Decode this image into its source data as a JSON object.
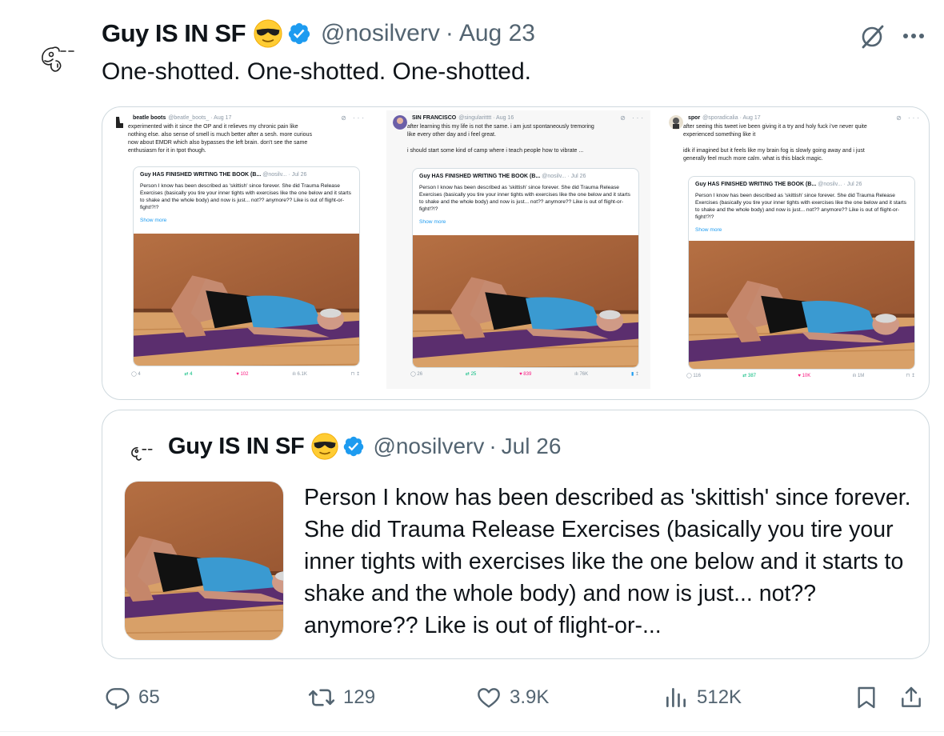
{
  "tweet": {
    "author_name": "Guy IS IN SF",
    "author_emoji": "sunglasses-face-emoji",
    "verified_badge": "verified-badge-icon",
    "handle": "@nosilverv",
    "separator": "·",
    "date": "Aug 23",
    "text": "One-shotted. One-shotted. One-shotted."
  },
  "media": {
    "screenshots": [
      {
        "name": "beatle boots",
        "handle": "@beatle_boots_ · Aug 17",
        "text": "experimented with it since the OP and it relieves my chronic pain like\nnothing else. also sense of smell is much better after a sesh. more curious\nnow about  EMDR which also bypasses the left brain. don't see the same\nenthusiasm for it in tpot though.",
        "quote_head": "Guy HAS FINISHED WRITING THE BOOK (B...",
        "quote_meta": "@nosilv... · Jul 26",
        "quote_text": "Person I know has been described as 'skittish' since forever. She did Trauma Release Exercises (basically you tire your inner tights with exercises like the one below and it starts to shake and the whole body) and now is just... not?? anymore?? Like is out of flight-or-fight!?!?",
        "show_more": "Show more",
        "replies": "4",
        "reposts": "4",
        "likes": "102",
        "views": "6.1K"
      },
      {
        "name": "SIN FRANCISCO",
        "handle": "@singularitttt · Aug 16",
        "text": "after learning this my life is not the same. i am just spontaneously tremoring\nlike every other day and i feel great.\n\ni should start some kind of camp where i teach people how to vibrate ...",
        "quote_head": "Guy HAS FINISHED WRITING THE BOOK (B...",
        "quote_meta": "@nosilv... · Jul 26",
        "quote_text": "Person I know has been described as 'skittish' since forever. She did Trauma Release Exercises (basically you tire your inner tights with exercises like the one below and it starts to shake and the whole body) and now is just... not?? anymore?? Like is out of flight-or-fight!?!?",
        "show_more": "Show more",
        "replies": "26",
        "reposts": "25",
        "likes": "839",
        "views": "76K"
      },
      {
        "name": "spor",
        "handle": "@sporadicalia · Aug 17",
        "text": "after seeing this tweet ive been giving it a try and holy fuck i've never quite\nexperienced something like it\n\nidk if imagined but it feels like my brain fog is slowly going away and i just\ngenerally feel much more calm. what is this black magic.",
        "quote_head": "Guy HAS FINISHED WRITING THE BOOK (B...",
        "quote_meta": "@nosilv... · Jul 26",
        "quote_text": "Person I know has been described as 'skittish' since forever. She did Trauma Release Exercises (basically you tire your inner tights with exercises like the one below and it starts to shake and the whole body) and now is just... not?? anymore?? Like is out of flight-or-fight!?!?",
        "show_more": "Show more",
        "replies": "116",
        "reposts": "387",
        "likes": "10K",
        "views": "1M"
      }
    ]
  },
  "quoted": {
    "author_name": "Guy IS IN SF",
    "handle": "@nosilverv",
    "separator": "·",
    "date": "Jul 26",
    "text": "Person I know has been described as 'skittish' since forever. She did Trauma Release Exercises (basically you tire your inner tights with exercises like the one below and it starts to shake and the whole body) and now is just... not?? anymore?? Like is out of flight-or-..."
  },
  "actions": {
    "replies": "65",
    "reposts": "129",
    "likes": "3.9K",
    "views": "512K"
  },
  "colors": {
    "text": "#0f1419",
    "secondary": "#536471",
    "verified": "#1d9bf0",
    "border": "#cfd9de",
    "like_pink": "#f91880",
    "repost_green": "#00ba7c"
  }
}
